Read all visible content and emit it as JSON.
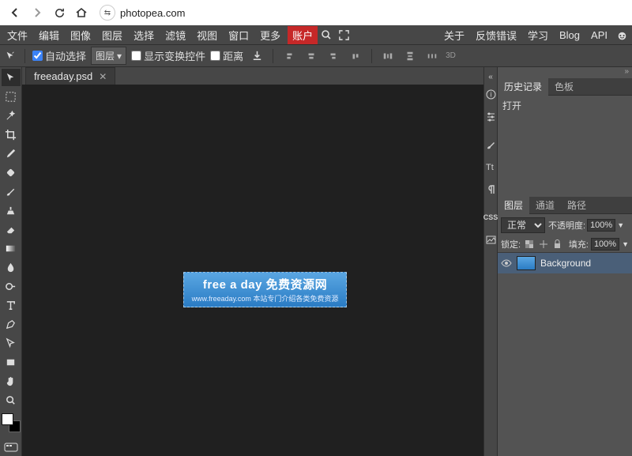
{
  "browser": {
    "url": "photopea.com"
  },
  "menu": {
    "items": [
      "文件",
      "编辑",
      "图像",
      "图层",
      "选择",
      "滤镜",
      "视图",
      "窗口",
      "更多"
    ],
    "account": "账户",
    "right": [
      "关于",
      "反馈错误",
      "学习",
      "Blog",
      "API"
    ]
  },
  "options": {
    "auto_select_label": "自动选择",
    "auto_select_checked": true,
    "target_label": "图层",
    "show_controls_label": "显示变换控件",
    "show_controls_checked": false,
    "distance_label": "距离",
    "distance_checked": false,
    "more_label": "3D"
  },
  "tabs": {
    "file": "freeaday.psd"
  },
  "canvas": {
    "title": "free a day 免费资源网",
    "subtitle": "www.freeaday.com 本站专门介绍各类免费资源"
  },
  "history_panel": {
    "tab_history": "历史记录",
    "tab_swatches": "色板",
    "entry0": "打开"
  },
  "layers_panel": {
    "tab_layers": "图层",
    "tab_channels": "通道",
    "tab_paths": "路径",
    "blend_mode": "正常",
    "opacity_label": "不透明度:",
    "opacity_value": "100%",
    "lock_label": "锁定:",
    "fill_label": "填充:",
    "fill_value": "100%",
    "layer0_name": "Background"
  },
  "rail": {
    "css": "CSS"
  }
}
